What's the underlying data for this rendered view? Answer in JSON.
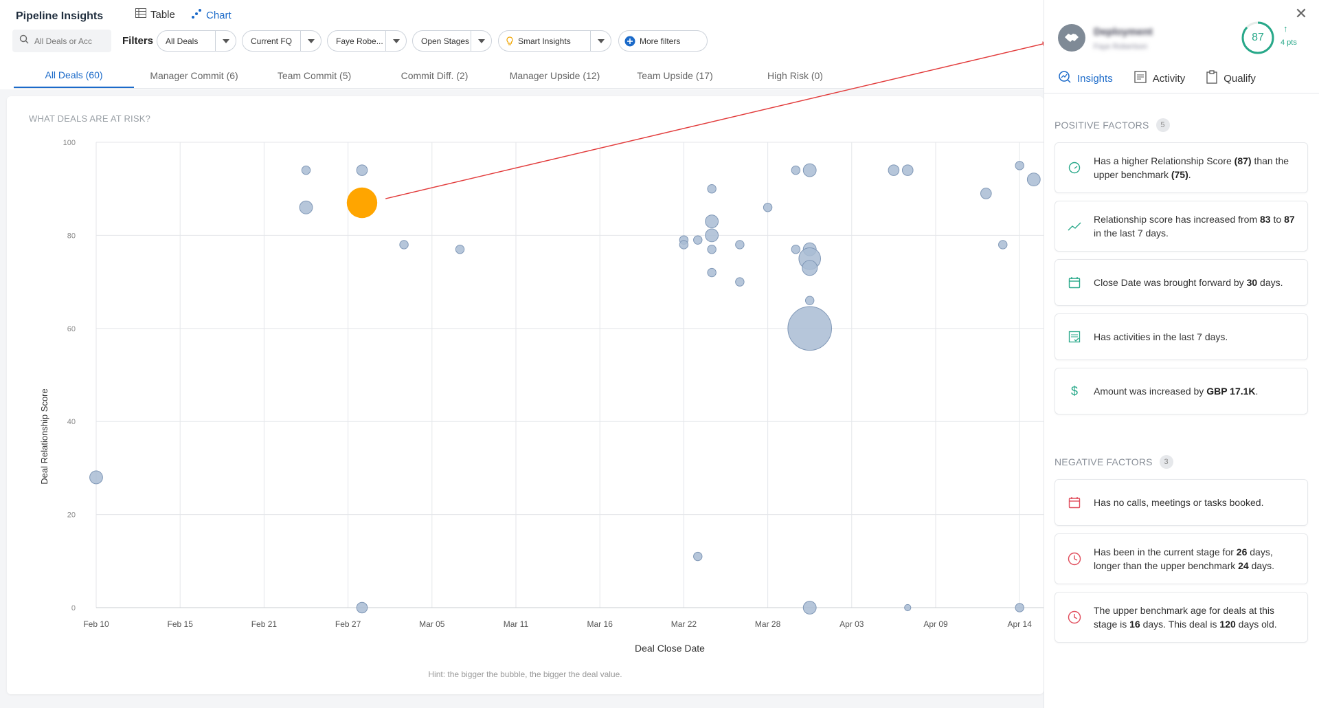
{
  "header": {
    "title": "Pipeline Insights",
    "view_table": "Table",
    "view_chart": "Chart",
    "search_placeholder": "All Deals or Acc",
    "filters_label": "Filters",
    "filters": [
      {
        "label": "All Deals"
      },
      {
        "label": "Current FQ"
      },
      {
        "label": "Faye Robe..."
      },
      {
        "label": "Open Stages"
      },
      {
        "label": "Smart Insights"
      },
      {
        "label": "More filters"
      }
    ]
  },
  "tabs": [
    {
      "label": "All Deals (60)",
      "active": true
    },
    {
      "label": "Manager Commit (6)"
    },
    {
      "label": "Team Commit (5)"
    },
    {
      "label": "Commit Diff. (2)"
    },
    {
      "label": "Manager Upside (12)"
    },
    {
      "label": "Team Upside (17)"
    },
    {
      "label": "High Risk (0)"
    }
  ],
  "chart": {
    "question": "WHAT DEALS ARE AT RISK?",
    "hint": "Hint: the bigger the bubble, the bigger the deal value."
  },
  "chart_data": {
    "type": "scatter",
    "title": "WHAT DEALS ARE AT RISK?",
    "xlabel": "Deal Close Date",
    "ylabel": "Deal Relationship Score",
    "x_ticks": [
      "Feb 10",
      "Feb 15",
      "Feb 21",
      "Feb 27",
      "Mar 05",
      "Mar 11",
      "Mar 16",
      "Mar 22",
      "Mar 28",
      "Apr 03",
      "Apr 09",
      "Apr 14"
    ],
    "y_ticks": [
      0,
      20,
      40,
      60,
      80,
      100
    ],
    "ylim": [
      0,
      100
    ],
    "grid": true,
    "legend": "none",
    "bubble_size_encodes": "deal value",
    "colors": {
      "bubble": "#a9bcd4",
      "bubble_stroke": "#7f97b6",
      "highlight": "#ffa500",
      "leader_line": "#e23b3b"
    },
    "points": [
      {
        "x": "Feb 10",
        "y": 28,
        "size": 2
      },
      {
        "x": "Feb 24",
        "y": 94,
        "size": 1
      },
      {
        "x": "Feb 24",
        "y": 86,
        "size": 2
      },
      {
        "x": "Feb 28",
        "y": 94,
        "size": 1.5
      },
      {
        "x": "Feb 28",
        "y": 87,
        "size": 6,
        "highlighted": true
      },
      {
        "x": "Feb 28",
        "y": 0,
        "size": 1.5
      },
      {
        "x": "Mar 03",
        "y": 78,
        "size": 1
      },
      {
        "x": "Mar 07",
        "y": 77,
        "size": 1
      },
      {
        "x": "Mar 22",
        "y": 79,
        "size": 1
      },
      {
        "x": "Mar 22",
        "y": 78,
        "size": 1
      },
      {
        "x": "Mar 23",
        "y": 11,
        "size": 1
      },
      {
        "x": "Mar 23",
        "y": 79,
        "size": 1
      },
      {
        "x": "Mar 24",
        "y": 90,
        "size": 1
      },
      {
        "x": "Mar 24",
        "y": 83,
        "size": 2
      },
      {
        "x": "Mar 24",
        "y": 80,
        "size": 2
      },
      {
        "x": "Mar 24",
        "y": 77,
        "size": 1
      },
      {
        "x": "Mar 24",
        "y": 72,
        "size": 1
      },
      {
        "x": "Mar 26",
        "y": 78,
        "size": 1
      },
      {
        "x": "Mar 26",
        "y": 70,
        "size": 1
      },
      {
        "x": "Mar 28",
        "y": 86,
        "size": 1
      },
      {
        "x": "Mar 30",
        "y": 94,
        "size": 1
      },
      {
        "x": "Mar 30",
        "y": 77,
        "size": 1
      },
      {
        "x": "Mar 31",
        "y": 94,
        "size": 2
      },
      {
        "x": "Mar 31",
        "y": 77,
        "size": 2
      },
      {
        "x": "Mar 31",
        "y": 75,
        "size": 4
      },
      {
        "x": "Mar 31",
        "y": 73,
        "size": 2.5
      },
      {
        "x": "Mar 31",
        "y": 66,
        "size": 1
      },
      {
        "x": "Mar 31",
        "y": 60,
        "size": 9
      },
      {
        "x": "Mar 31",
        "y": 0,
        "size": 2
      },
      {
        "x": "Apr 06",
        "y": 94,
        "size": 1.5
      },
      {
        "x": "Apr 07",
        "y": 94,
        "size": 1.5
      },
      {
        "x": "Apr 07",
        "y": 0,
        "size": 0.5
      },
      {
        "x": "Apr 12",
        "y": 89,
        "size": 1.5
      },
      {
        "x": "Apr 13",
        "y": 78,
        "size": 1
      },
      {
        "x": "Apr 14",
        "y": 95,
        "size": 1
      },
      {
        "x": "Apr 14",
        "y": 0,
        "size": 1
      },
      {
        "x": "Apr 15",
        "y": 92,
        "size": 2
      }
    ]
  },
  "panel": {
    "account_name": "Deployment",
    "account_sub": "Faye Robertson",
    "score": "87",
    "score_arrow": "↑",
    "score_delta": "4 pts",
    "score_fraction": 0.87,
    "tabs": [
      {
        "label": "Insights",
        "active": true
      },
      {
        "label": "Activity"
      },
      {
        "label": "Qualify"
      }
    ],
    "positive_title": "POSITIVE FACTORS",
    "positive_count": "5",
    "negative_title": "NEGATIVE FACTORS",
    "negative_count": "3",
    "positive_factors": [
      {
        "icon": "gauge-icon",
        "parts": [
          {
            "t": "Has a higher Relationship Score "
          },
          {
            "t": "(87)",
            "b": true
          },
          {
            "t": " than the upper benchmark "
          },
          {
            "t": "(75)",
            "b": true
          },
          {
            "t": "."
          }
        ]
      },
      {
        "icon": "trend-up-icon",
        "parts": [
          {
            "t": "Relationship score has increased from "
          },
          {
            "t": "83",
            "b": true
          },
          {
            "t": " to "
          },
          {
            "t": "87",
            "b": true
          },
          {
            "t": " in the last 7 days."
          }
        ]
      },
      {
        "icon": "calendar-icon",
        "parts": [
          {
            "t": "Close Date was brought forward by "
          },
          {
            "t": "30",
            "b": true
          },
          {
            "t": " days."
          }
        ]
      },
      {
        "icon": "checklist-icon",
        "parts": [
          {
            "t": "Has activities in the last 7 days."
          }
        ]
      },
      {
        "icon": "dollar-icon",
        "parts": [
          {
            "t": "Amount was increased by "
          },
          {
            "t": "GBP 17.1K",
            "b": true
          },
          {
            "t": "."
          }
        ]
      }
    ],
    "negative_factors": [
      {
        "icon": "calendar-icon",
        "parts": [
          {
            "t": "Has no calls, meetings or tasks booked."
          }
        ]
      },
      {
        "icon": "clock-icon",
        "parts": [
          {
            "t": "Has been in the current stage for "
          },
          {
            "t": "26",
            "b": true
          },
          {
            "t": " days, longer than the upper benchmark "
          },
          {
            "t": "24",
            "b": true
          },
          {
            "t": " days."
          }
        ]
      },
      {
        "icon": "clock-icon",
        "parts": [
          {
            "t": "The upper benchmark age for deals at this stage is "
          },
          {
            "t": "16",
            "b": true
          },
          {
            "t": " days. This deal is "
          },
          {
            "t": "120",
            "b": true
          },
          {
            "t": " days old."
          }
        ]
      }
    ],
    "colors": {
      "positive": "#27a889",
      "negative": "#e04b5a",
      "accent": "#1b6ac9"
    }
  }
}
